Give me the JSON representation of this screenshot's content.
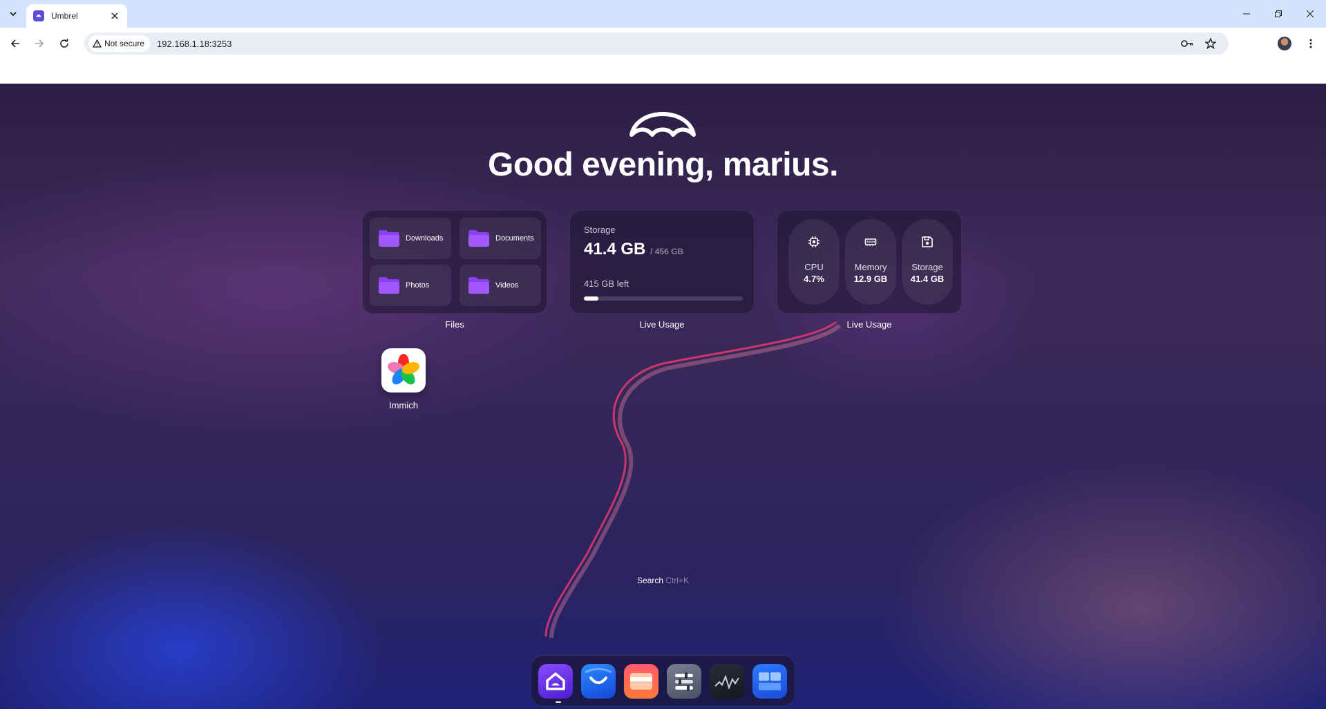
{
  "browser": {
    "tab_title": "Umbrel",
    "security_label": "Not secure",
    "url": "192.168.1.18:3253"
  },
  "page": {
    "greeting": "Good evening, marius."
  },
  "files_widget": {
    "caption": "Files",
    "folders": [
      "Downloads",
      "Documents",
      "Photos",
      "Videos"
    ]
  },
  "storage_widget": {
    "caption": "Live Usage",
    "title": "Storage",
    "used": "41.4 GB",
    "total": "/ 456 GB",
    "left": "415 GB left",
    "used_fraction": 0.09
  },
  "usage_widget": {
    "caption": "Live Usage",
    "stats": [
      {
        "name": "CPU",
        "value": "4.7%",
        "icon": "cpu-icon"
      },
      {
        "name": "Memory",
        "value": "12.9 GB",
        "icon": "memory-icon"
      },
      {
        "name": "Storage",
        "value": "41.4 GB",
        "icon": "save-icon"
      }
    ]
  },
  "apps": [
    {
      "name": "Immich",
      "icon": "immich-icon"
    }
  ],
  "search": {
    "label": "Search",
    "shortcut": "Ctrl+K"
  },
  "dock": {
    "items": [
      "home-icon",
      "app-store-icon",
      "settings-card-icon",
      "controls-icon",
      "live-usage-icon",
      "widgets-icon"
    ]
  },
  "colors": {
    "accent": "#5b4bd8",
    "folder": "#8a3ff0"
  }
}
